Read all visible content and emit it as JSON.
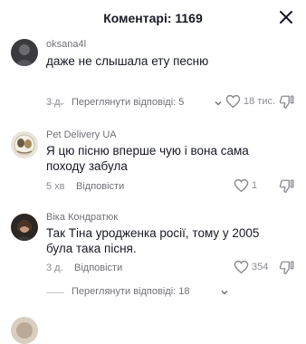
{
  "header": {
    "title": "Коментарі: 1169",
    "close_icon": "close-icon"
  },
  "comments": [
    {
      "username": "oksana4l",
      "text": "даже не слышала ету песню",
      "time": "3 д.",
      "reply_label": "",
      "likes": "18 тис.",
      "view_replies": "Переглянути відповіді: 5"
    },
    {
      "username": "Pet Delivery UA",
      "text": "Я цю пісню вперше чую і вона сама походу забула",
      "time": "5 хв",
      "reply_label": "Відповісти",
      "likes": "1",
      "view_replies": ""
    },
    {
      "username": "Віка Кондратюк",
      "text": "Так Тіна уродженка росії, тому у 2005 була така пісня.",
      "time": "3 д.",
      "reply_label": "Відповісти",
      "likes": "354",
      "view_replies": "Переглянути відповіді: 18"
    }
  ],
  "icons": {
    "like": "heart-outline-icon",
    "dislike": "thumb-down-icon",
    "expand": "chevron-down-icon"
  },
  "colors": {
    "text": "#161823",
    "secondary": "#6f7076",
    "muted": "#8a8b91",
    "background": "#ffffff"
  }
}
